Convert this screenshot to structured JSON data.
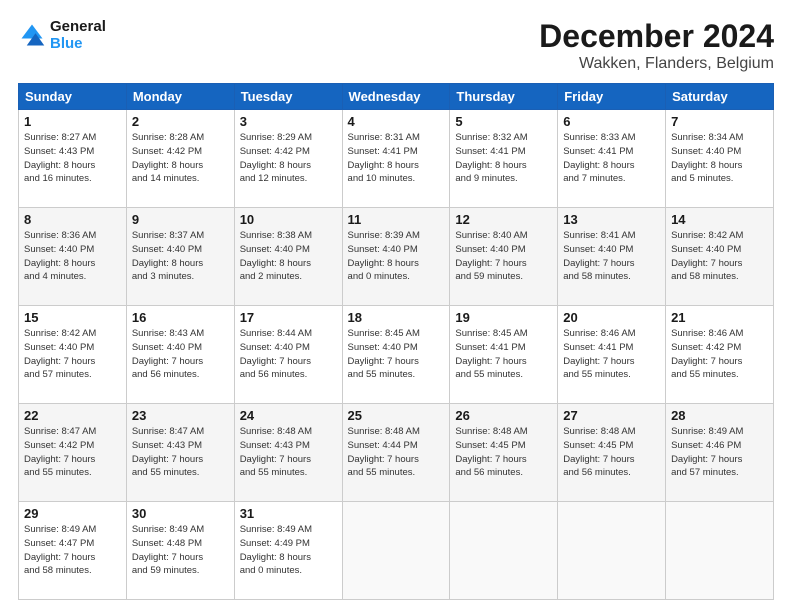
{
  "header": {
    "logo_line1": "General",
    "logo_line2": "Blue",
    "month": "December 2024",
    "location": "Wakken, Flanders, Belgium"
  },
  "weekdays": [
    "Sunday",
    "Monday",
    "Tuesday",
    "Wednesday",
    "Thursday",
    "Friday",
    "Saturday"
  ],
  "weeks": [
    [
      {
        "day": "1",
        "info": "Sunrise: 8:27 AM\nSunset: 4:43 PM\nDaylight: 8 hours\nand 16 minutes."
      },
      {
        "day": "2",
        "info": "Sunrise: 8:28 AM\nSunset: 4:42 PM\nDaylight: 8 hours\nand 14 minutes."
      },
      {
        "day": "3",
        "info": "Sunrise: 8:29 AM\nSunset: 4:42 PM\nDaylight: 8 hours\nand 12 minutes."
      },
      {
        "day": "4",
        "info": "Sunrise: 8:31 AM\nSunset: 4:41 PM\nDaylight: 8 hours\nand 10 minutes."
      },
      {
        "day": "5",
        "info": "Sunrise: 8:32 AM\nSunset: 4:41 PM\nDaylight: 8 hours\nand 9 minutes."
      },
      {
        "day": "6",
        "info": "Sunrise: 8:33 AM\nSunset: 4:41 PM\nDaylight: 8 hours\nand 7 minutes."
      },
      {
        "day": "7",
        "info": "Sunrise: 8:34 AM\nSunset: 4:40 PM\nDaylight: 8 hours\nand 5 minutes."
      }
    ],
    [
      {
        "day": "8",
        "info": "Sunrise: 8:36 AM\nSunset: 4:40 PM\nDaylight: 8 hours\nand 4 minutes."
      },
      {
        "day": "9",
        "info": "Sunrise: 8:37 AM\nSunset: 4:40 PM\nDaylight: 8 hours\nand 3 minutes."
      },
      {
        "day": "10",
        "info": "Sunrise: 8:38 AM\nSunset: 4:40 PM\nDaylight: 8 hours\nand 2 minutes."
      },
      {
        "day": "11",
        "info": "Sunrise: 8:39 AM\nSunset: 4:40 PM\nDaylight: 8 hours\nand 0 minutes."
      },
      {
        "day": "12",
        "info": "Sunrise: 8:40 AM\nSunset: 4:40 PM\nDaylight: 7 hours\nand 59 minutes."
      },
      {
        "day": "13",
        "info": "Sunrise: 8:41 AM\nSunset: 4:40 PM\nDaylight: 7 hours\nand 58 minutes."
      },
      {
        "day": "14",
        "info": "Sunrise: 8:42 AM\nSunset: 4:40 PM\nDaylight: 7 hours\nand 58 minutes."
      }
    ],
    [
      {
        "day": "15",
        "info": "Sunrise: 8:42 AM\nSunset: 4:40 PM\nDaylight: 7 hours\nand 57 minutes."
      },
      {
        "day": "16",
        "info": "Sunrise: 8:43 AM\nSunset: 4:40 PM\nDaylight: 7 hours\nand 56 minutes."
      },
      {
        "day": "17",
        "info": "Sunrise: 8:44 AM\nSunset: 4:40 PM\nDaylight: 7 hours\nand 56 minutes."
      },
      {
        "day": "18",
        "info": "Sunrise: 8:45 AM\nSunset: 4:40 PM\nDaylight: 7 hours\nand 55 minutes."
      },
      {
        "day": "19",
        "info": "Sunrise: 8:45 AM\nSunset: 4:41 PM\nDaylight: 7 hours\nand 55 minutes."
      },
      {
        "day": "20",
        "info": "Sunrise: 8:46 AM\nSunset: 4:41 PM\nDaylight: 7 hours\nand 55 minutes."
      },
      {
        "day": "21",
        "info": "Sunrise: 8:46 AM\nSunset: 4:42 PM\nDaylight: 7 hours\nand 55 minutes."
      }
    ],
    [
      {
        "day": "22",
        "info": "Sunrise: 8:47 AM\nSunset: 4:42 PM\nDaylight: 7 hours\nand 55 minutes."
      },
      {
        "day": "23",
        "info": "Sunrise: 8:47 AM\nSunset: 4:43 PM\nDaylight: 7 hours\nand 55 minutes."
      },
      {
        "day": "24",
        "info": "Sunrise: 8:48 AM\nSunset: 4:43 PM\nDaylight: 7 hours\nand 55 minutes."
      },
      {
        "day": "25",
        "info": "Sunrise: 8:48 AM\nSunset: 4:44 PM\nDaylight: 7 hours\nand 55 minutes."
      },
      {
        "day": "26",
        "info": "Sunrise: 8:48 AM\nSunset: 4:45 PM\nDaylight: 7 hours\nand 56 minutes."
      },
      {
        "day": "27",
        "info": "Sunrise: 8:48 AM\nSunset: 4:45 PM\nDaylight: 7 hours\nand 56 minutes."
      },
      {
        "day": "28",
        "info": "Sunrise: 8:49 AM\nSunset: 4:46 PM\nDaylight: 7 hours\nand 57 minutes."
      }
    ],
    [
      {
        "day": "29",
        "info": "Sunrise: 8:49 AM\nSunset: 4:47 PM\nDaylight: 7 hours\nand 58 minutes."
      },
      {
        "day": "30",
        "info": "Sunrise: 8:49 AM\nSunset: 4:48 PM\nDaylight: 7 hours\nand 59 minutes."
      },
      {
        "day": "31",
        "info": "Sunrise: 8:49 AM\nSunset: 4:49 PM\nDaylight: 8 hours\nand 0 minutes."
      },
      null,
      null,
      null,
      null
    ]
  ]
}
